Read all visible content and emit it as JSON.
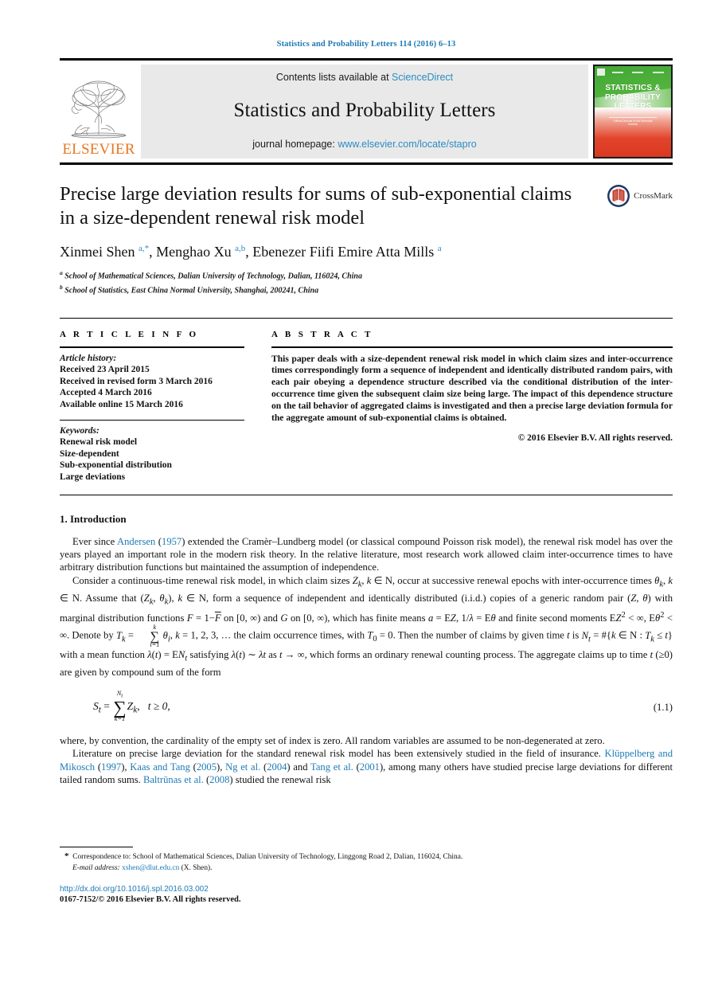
{
  "running_head": "Statistics and Probability Letters 114 (2016) 6–13",
  "masthead": {
    "publisher_name": "ELSEVIER",
    "contents_prefix": "Contents lists available at ",
    "contents_link": "ScienceDirect",
    "journal_name": "Statistics and Probability Letters",
    "homepage_prefix": "journal homepage: ",
    "homepage_url": "www.elsevier.com/locate/stapro",
    "cover": {
      "title_line1": "STATISTICS &",
      "title_line2": "PROBABILITY",
      "title_line3": "LETTERS",
      "subtitle": "Official Journal of the Bernoulli Society"
    }
  },
  "article": {
    "title": "Precise large deviation results for sums of sub-exponential claims in a size-dependent renewal risk model",
    "crossmark_label": "CrossMark",
    "authors_html": "Xinmei Shen <sup>a,*</sup>, Menghao Xu <sup>a,b</sup>, Ebenezer Fiifi Emire Atta Mills <sup>a</sup>",
    "affiliations": [
      {
        "marker": "a",
        "text": "School of Mathematical Sciences, Dalian University of Technology, Dalian, 116024, China"
      },
      {
        "marker": "b",
        "text": "School of Statistics, East China Normal University, Shanghai, 200241, China"
      }
    ]
  },
  "info": {
    "heading": "A R T I C L E   I N F O",
    "history_label": "Article history:",
    "history": [
      "Received 23 April 2015",
      "Received in revised form 3 March 2016",
      "Accepted 4 March 2016",
      "Available online 15 March 2016"
    ],
    "keywords_label": "Keywords:",
    "keywords": [
      "Renewal risk model",
      "Size-dependent",
      "Sub-exponential distribution",
      "Large deviations"
    ]
  },
  "abstract": {
    "heading": "A B S T R A C T",
    "text": "This paper deals with a size-dependent renewal risk model in which claim sizes and inter-occurrence times correspondingly form a sequence of independent and identically distributed random pairs, with each pair obeying a dependence structure described via the conditional distribution of the inter-occurrence time given the subsequent claim size being large. The impact of this dependence structure on the tail behavior of aggregated claims is investigated and then a precise large deviation formula for the aggregate amount of sub-exponential claims is obtained.",
    "copyright": "© 2016 Elsevier B.V. All rights reserved."
  },
  "introduction": {
    "heading": "1.  Introduction",
    "para1_html": "Ever since <span class=\"lnk\">Andersen</span> (<span class=\"lnk\">1957</span>) extended the Cramèr–Lundberg model (or classical compound Poisson risk model), the renewal risk model has over the years played an important role in the modern risk theory. In the relative literature, most research work allowed claim inter-occurrence times to have arbitrary distribution functions but maintained the assumption of independence.",
    "para2_html": "Consider a continuous-time renewal risk model, in which claim sizes <i>Z<sub>k</sub></i>, <i>k</i> ∈ N, occur at successive renewal epochs with inter-occurrence times <i>θ<sub>k</sub></i>, <i>k</i> ∈ N. Assume that (<i>Z<sub>k</sub></i>, <i>θ<sub>k</sub></i>), <i>k</i> ∈ N, form a sequence of independent and identically distributed (i.i.d.) copies of a generic random pair (<i>Z</i>, <i>θ</i>) with marginal distribution functions <i>F</i> = 1−<span style=\"text-decoration:overline\"><i>F</i></span> on [0, ∞) and <i>G</i> on [0, ∞), which has finite means <i>a</i> = E<i>Z</i>, 1/<i>λ</i> = E<i>θ</i> and finite second moments E<i>Z</i><sup>2</sup> &lt; ∞, E<i>θ</i><sup>2</sup> &lt; ∞. Denote by <i>T<sub>k</sub></i> = ",
    "para2_html_tail": " <i>θ<sub>i</sub></i>, <i>k</i> = 1, 2, 3, … the claim occurrence times, with <i>T</i><sub>0</sub> = 0. Then the number of claims by given time <i>t</i> is <i>N<sub>t</sub></i> = #{<i>k</i> ∈ N : <i>T<sub>k</sub></i> ≤ <i>t</i>} with a mean function <i>λ</i>(<i>t</i>) = E<i>N<sub>t</sub></i> satisfying <i>λ</i>(<i>t</i>) ∼ <i>λt</i> as <i>t</i> → ∞, which forms an ordinary renewal counting process. The aggregate claims up to time <i>t</i> (≥0) are given by compound sum of the form",
    "equation": {
      "lhs": "S",
      "lhs_sub": "t",
      "sum_upper": "N",
      "sum_upper_sub": "t",
      "sum_lower": "k=1",
      "summand": "Z",
      "summand_sub": "k",
      "condition": "t ≥ 0,",
      "number": "(1.1)"
    },
    "para3_html": "where, by convention, the cardinality of the empty set of index is zero. All random variables are assumed to be non-degenerated at zero.",
    "para4_html": "Literature on precise large deviation for the standard renewal risk model has been extensively studied in the field of insurance. <span class=\"lnk\">Klüppelberg and Mikosch</span> (<span class=\"lnk\">1997</span>), <span class=\"lnk\">Kaas and Tang</span> (<span class=\"lnk\">2005</span>), <span class=\"lnk\">Ng et al.</span> (<span class=\"lnk\">2004</span>) and <span class=\"lnk\">Tang et al.</span> (<span class=\"lnk\">2001</span>), among many others have studied precise large deviations for different tailed random sums. <span class=\"lnk\">Baltrūnas et al.</span> (<span class=\"lnk\">2008</span>) studied the renewal risk"
  },
  "footnotes": {
    "correspondence_html": "<span class=\"star\">*</span>&nbsp; Correspondence to: School of Mathematical Sciences, Dalian University of Technology, Linggong Road 2, Dalian, 116024, China.",
    "email_label": "E-mail address:",
    "email": "xshen@dlut.edu.cn",
    "email_owner": "(X. Shen).",
    "doi": "http://dx.doi.org/10.1016/j.spl.2016.03.002",
    "issn_line": "0167-7152/© 2016 Elsevier B.V. All rights reserved."
  },
  "colors": {
    "link_blue": "#1e7ab5",
    "elsevier_orange": "#E87722",
    "cover_green": "#4cb03a",
    "cover_red": "#e2452c"
  }
}
